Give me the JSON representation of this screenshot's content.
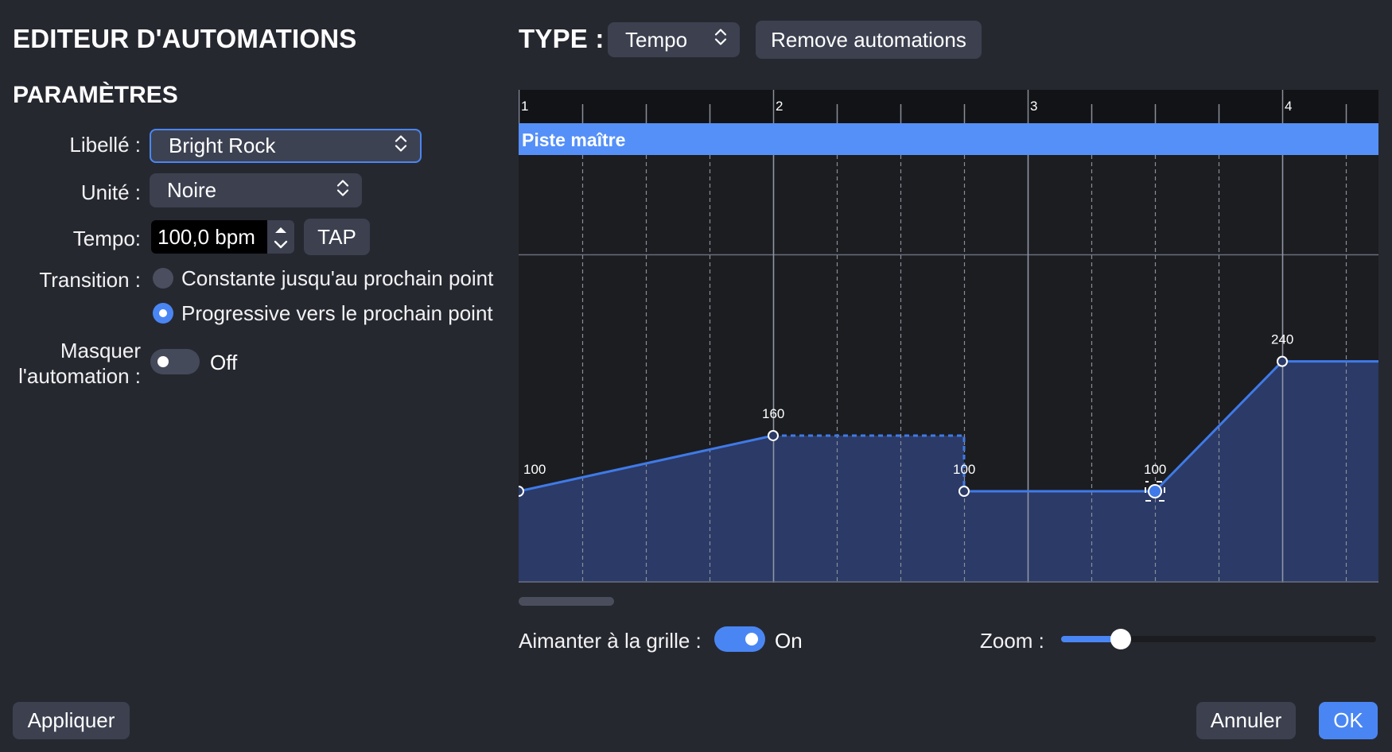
{
  "editor": {
    "title": "EDITEUR D'AUTOMATIONS",
    "params_title": "PARAMÈTRES"
  },
  "params": {
    "label_label": "Libellé :",
    "label_value": "Bright Rock",
    "unit_label": "Unité :",
    "unit_value": "Noire",
    "tempo_label": "Tempo:",
    "tempo_value": "100,0 bpm",
    "tap_label": "TAP",
    "transition_label": "Transition :",
    "transition_options": [
      {
        "text": "Constante jusqu'au prochain point",
        "selected": false
      },
      {
        "text": "Progressive vers le prochain point",
        "selected": true
      }
    ],
    "hide_label_line1": "Masquer",
    "hide_label_line2": "l'automation :",
    "hide_state": "Off",
    "hide_on": false
  },
  "type_bar": {
    "type_label": "TYPE :",
    "type_value": "Tempo",
    "remove_button": "Remove automations"
  },
  "timeline": {
    "track_name": "Piste maître",
    "bars": [
      "1",
      "2",
      "3",
      "4"
    ],
    "beats_per_bar": 4,
    "points": [
      {
        "beat": 0,
        "value": 100,
        "label": "100"
      },
      {
        "beat": 4,
        "value": 160,
        "label": "160"
      },
      {
        "beat": 7,
        "value": 100,
        "label": "100"
      },
      {
        "beat": 10,
        "value": 100,
        "label": "100",
        "selected": true
      },
      {
        "beat": 12,
        "value": 240,
        "label": "240"
      }
    ],
    "constant_segment": {
      "from_beat": 4,
      "to_beat": 7,
      "value": 160
    }
  },
  "footer": {
    "snap_label": "Aimanter à la grille :",
    "snap_state": "On",
    "snap_on": true,
    "zoom_label": "Zoom :",
    "zoom_level": 0.19,
    "apply_button": "Appliquer",
    "cancel_button": "Annuler",
    "ok_button": "OK"
  },
  "colors": {
    "background": "#262830",
    "control": "#3c404f",
    "accent": "#4a86f3",
    "track_bar": "#5590f8",
    "curve": "#3f7ae8",
    "fill": "#2b3a66",
    "grid_bg": "#1c1d21"
  },
  "icons": {
    "select_chevron": "chevron-up-down-icon",
    "stepper": "stepper-arrows-icon"
  }
}
